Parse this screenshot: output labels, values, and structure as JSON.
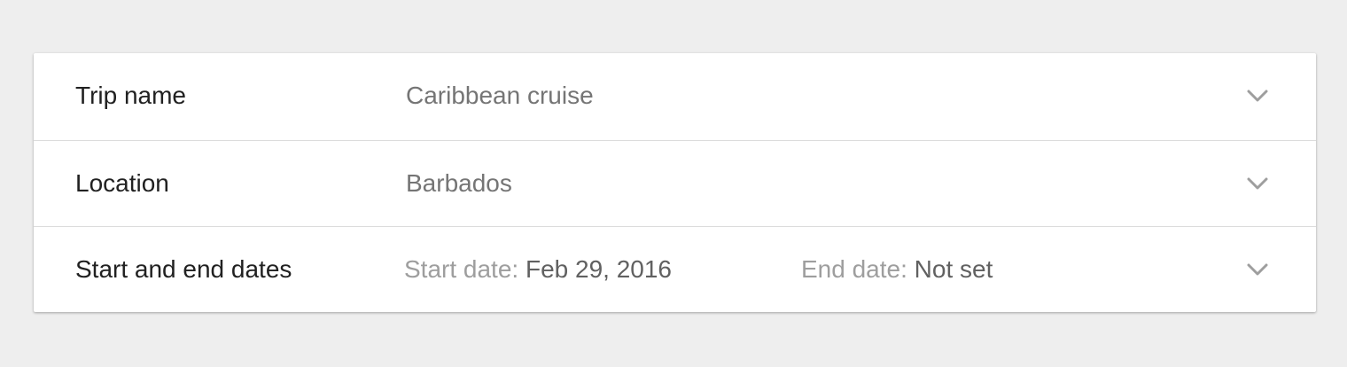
{
  "rows": [
    {
      "title": "Trip name",
      "value": "Caribbean cruise",
      "icon": "chevron-down-icon"
    },
    {
      "title": "Location",
      "value": "Barbados",
      "icon": "chevron-down-icon"
    },
    {
      "title": "Start and end dates",
      "start_label": "Start date:",
      "start_value": "Feb 29, 2016",
      "end_label": "End date:",
      "end_value": "Not set",
      "icon": "chevron-down-icon"
    }
  ],
  "colors": {
    "background": "#eeeeee",
    "panel": "#ffffff",
    "title_text": "#212121",
    "value_text": "#757575",
    "label_text": "#9e9e9e",
    "chevron": "#9e9e9e"
  }
}
